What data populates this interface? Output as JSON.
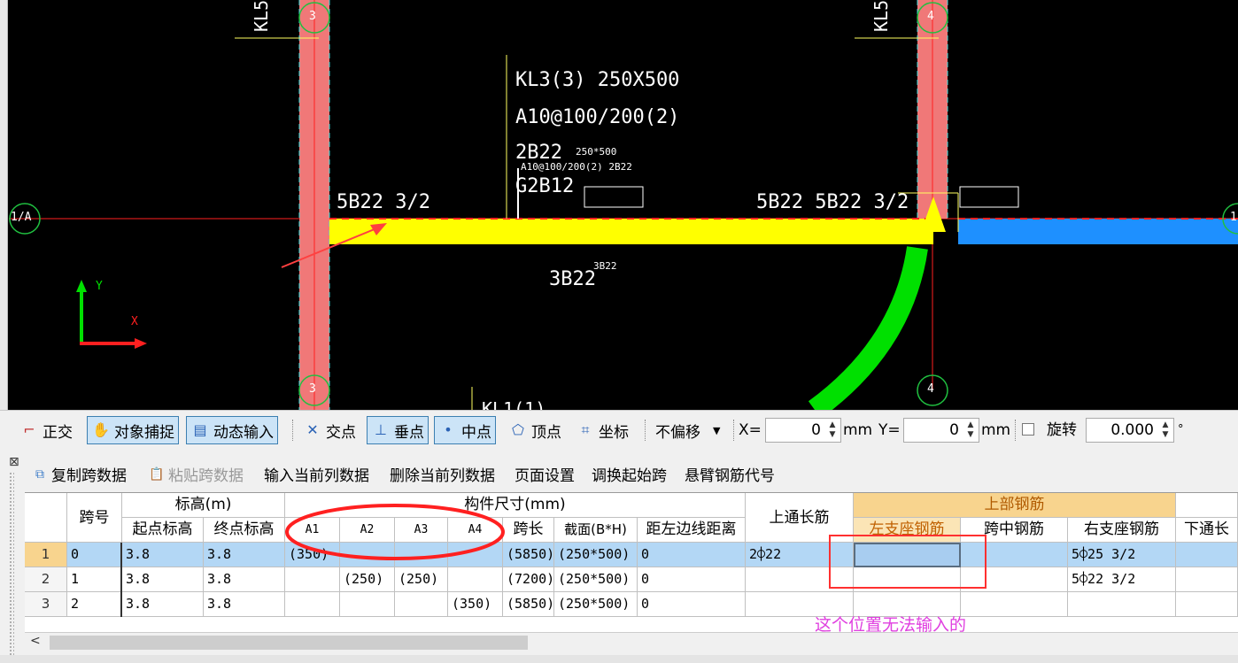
{
  "canvas": {
    "column_labels": {
      "left": "KL5",
      "right": "KL5"
    },
    "axis_bubbles": {
      "top_left": "3",
      "top_right": "4",
      "bottom_left": "3",
      "bottom_right": "4",
      "left": "1/A",
      "right": "1"
    },
    "beam_annotation": {
      "line1": "KL3(3) 250X500",
      "line2": "A10@100/200(2)",
      "line3": "2B22",
      "line4": "G2B12",
      "overlap_small1": "250*500",
      "overlap_small2": "A10@100/200(2) 2B22",
      "left_support": "5B22 3/2",
      "right_support": "5B22 5B22 3/2",
      "right_support_small": "5B22 3/2",
      "bottom": "3B22",
      "bottom_small": "3B22",
      "bottom_cut": "KL1(1)"
    },
    "axes": {
      "y": "Y",
      "x": "X"
    },
    "colors": {
      "column": "#f07878",
      "beam_yellow": "#ffff00",
      "beam_blue": "#1e90ff",
      "arc_green": "#00e000",
      "axis_red": "#ff2020",
      "grid_green": "#20c040"
    }
  },
  "snapbar": {
    "ortho": "正交",
    "object_snap": "对象捕捉",
    "dynamic_input": "动态输入",
    "intersection": "交点",
    "perpendicular": "垂点",
    "midpoint": "中点",
    "vertex": "顶点",
    "coordinate": "坐标",
    "offset_select": "不偏移",
    "x_label": "X=",
    "x_value": "0",
    "y_label": "Y=",
    "y_value": "0",
    "unit": "mm",
    "rotate_label": "旋转",
    "rotate_value": "0.000",
    "degree": "°"
  },
  "panel_toolbar": {
    "copy_span": "复制跨数据",
    "paste_span": "粘贴跨数据",
    "input_column": "输入当前列数据",
    "delete_column": "删除当前列数据",
    "page_setup": "页面设置",
    "swap_start": "调换起始跨",
    "cantilever_code": "悬臂钢筋代号"
  },
  "table": {
    "headers": {
      "span_no": "跨号",
      "elevation": "标高(m)",
      "start_elev": "起点标高",
      "end_elev": "终点标高",
      "dimensions": "构件尺寸(mm)",
      "a1": "A1",
      "a2": "A2",
      "a3": "A3",
      "a4": "A4",
      "span_len": "跨长",
      "section": "截面(B*H)",
      "dist_left": "距左边线距离",
      "top_through": "上通长筋",
      "top_rebar": "上部钢筋",
      "left_support": "左支座钢筋",
      "mid_span": "跨中钢筋",
      "right_support": "右支座钢筋",
      "bottom_through": "下通长"
    },
    "rows": [
      {
        "n": "1",
        "span": "0",
        "start": "3.8",
        "end": "3.8",
        "a1": "(350)",
        "a2": "",
        "a3": "",
        "a4": "",
        "len": "(5850)",
        "section": "(250*500)",
        "dist": "0",
        "top": "2⌽22",
        "left": "",
        "mid": "",
        "right": "5⌽25 3/2",
        "bottom": ""
      },
      {
        "n": "2",
        "span": "1",
        "start": "3.8",
        "end": "3.8",
        "a1": "",
        "a2": "(250)",
        "a3": "(250)",
        "a4": "",
        "len": "(7200)",
        "section": "(250*500)",
        "dist": "0",
        "top": "",
        "left": "",
        "mid": "",
        "right": "5⌽22 3/2",
        "bottom": ""
      },
      {
        "n": "3",
        "span": "2",
        "start": "3.8",
        "end": "3.8",
        "a1": "",
        "a2": "",
        "a3": "",
        "a4": "(350)",
        "len": "(5850)",
        "section": "(250*500)",
        "dist": "0",
        "top": "",
        "left": "",
        "mid": "",
        "right": "",
        "bottom": ""
      }
    ]
  },
  "note": "这个位置无法输入的"
}
